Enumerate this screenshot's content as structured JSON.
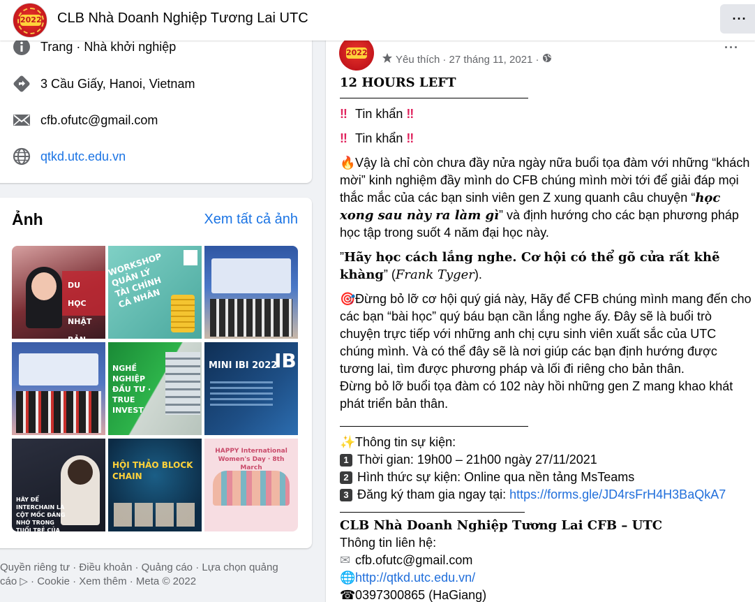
{
  "header": {
    "page_name": "CLB Nhà Doanh Nghiệp Tương Lai UTC",
    "logo_text": "2022",
    "more_label": "···"
  },
  "intro": {
    "category_prefix": "Trang",
    "category": " · Nhà khởi nghiệp",
    "address": "3 Cầu Giấy, Hanoi, Vietnam",
    "email": "cfb.ofutc@gmail.com",
    "website": "qtkd.utc.edu.vn"
  },
  "photos": {
    "title": "Ảnh",
    "see_all": "Xem tất cả ảnh",
    "tiles": [
      {
        "caption": "DU HỌC NHẬT BẢN",
        "bg": "#8d3b3b"
      },
      {
        "caption": "WORKSHOP QUẢN LÝ TÀI CHÍNH CÁ NHÂN",
        "bg": "#5bb8ae"
      },
      {
        "caption": "",
        "bg": "#3c63a8"
      },
      {
        "caption": "",
        "bg": "#4c68a8"
      },
      {
        "caption": "NGHỀ NGHIỆP ĐẦU TƯ · TRUE INVEST",
        "bg": "#1e8f3c"
      },
      {
        "caption": "MINI IBI 2022",
        "bg": "#173a63"
      },
      {
        "caption": "HÃY ĐỂ INTERCHAIN LÀ CỘT MỐC ĐÁNG NHỚ TRONG TUỔI TRẺ CỦA BẠN",
        "bg": "#1d2130"
      },
      {
        "caption": "HỘI THẢO BLOCK CHAIN",
        "bg": "#0e3452"
      },
      {
        "caption": "HAPPY International Women's Day · 8th March",
        "bg": "#f6dbe0"
      }
    ]
  },
  "footer": {
    "line1": "Quyền riêng tư · Điều khoản · Quảng cáo · Lựa chọn quảng",
    "line2": "cáo ▷ · Cookie · Xem thêm · Meta © 2022"
  },
  "post": {
    "meta_prefix": "Yêu thích",
    "date": " · 27 tháng 11, 2021 ·",
    "headline": "12 HOURS LEFT",
    "urgent_1": "Tin khẩn",
    "urgent_2": "Tin khẩn",
    "para1_a": "Vậy là chỉ còn chưa đầy nửa ngày nữa buổi tọa đàm với những “khách mời” kinh nghiệm đầy mình do CFB chúng mình mời tới để giải đáp mọi thắc mắc của các bạn sinh viên gen Z xung quanh câu chuyện “",
    "para1_b": "học xong sau này ra làm gì",
    "para1_c": "” và định hướng cho các bạn phương pháp học tập trong suốt 4 năm đại học này.",
    "quote_a": "”",
    "quote_b": "Hãy học cách lắng nghe. Cơ hội có thể gõ cửa rất khẽ khàng",
    "quote_c": "” (",
    "quote_d": "Frank Tyger",
    "quote_e": ").",
    "para2": "Đừng bỏ lỡ cơ hội quý giá này, Hãy để CFB chúng mình mang đến cho các bạn “bài học” quý báu bạn cần lắng nghe ấy. Đây sẽ là buổi trò chuyện trực tiếp với những anh chị cựu sinh viên xuất sắc của UTC chúng mình. Và có thể đây sẽ là nơi giúp các bạn định hướng được tương lai, tìm được phương pháp và lối đi riêng cho bản thân.",
    "para3": "Đừng bỏ lỡ buổi tọa đàm có 102 này hồi những gen Z mang khao khát phát triển bản thân.",
    "event_title": "Thông tin sự kiện:",
    "event_time": "Thời gian: 19h00 – 21h00 ngày 27/11/2021",
    "event_form": "Hình thức sự kiện: Online qua nền tảng MsTeams",
    "event_reg_label": "Đăng ký tham gia ngay tại: ",
    "event_reg_link": "https://forms.gle/JD4rsFrH4H3BaQkA7",
    "org_name": "CLB Nhà Doanh Nghiệp Tương Lai CFB – UTC",
    "contact_title": "Thông tin liên hệ:",
    "contact_email": "cfb.ofutc@gmail.com",
    "contact_site": "http://qtkd.utc.edu.vn/",
    "contact_phone": "0397300865 (HaGiang)"
  },
  "colors": {
    "link": "#1b74e4",
    "brand_red": "#c4161c",
    "muted": "#65676b"
  }
}
